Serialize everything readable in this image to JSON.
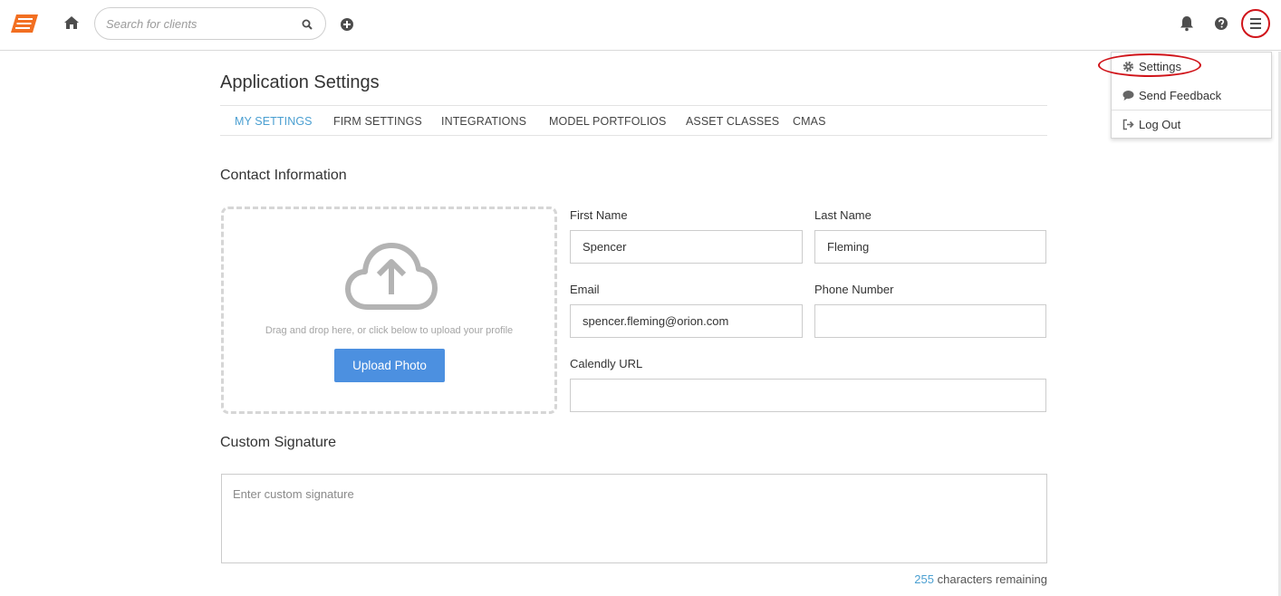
{
  "header": {
    "search": {
      "placeholder": "Search for clients",
      "value": ""
    }
  },
  "user_menu": {
    "items": [
      {
        "label": "Settings",
        "icon": "gear-icon"
      },
      {
        "label": "Send Feedback",
        "icon": "comment-icon"
      },
      {
        "label": "Log Out",
        "icon": "sign-out-icon"
      }
    ]
  },
  "page": {
    "title": "Application Settings",
    "tabs": [
      {
        "label": "MY SETTINGS",
        "active": true
      },
      {
        "label": "FIRM SETTINGS",
        "active": false
      },
      {
        "label": "INTEGRATIONS",
        "active": false
      },
      {
        "label": "MODEL PORTFOLIOS",
        "active": false
      },
      {
        "label": "ASSET CLASSES",
        "active": false
      },
      {
        "label": "CMAS",
        "active": false
      }
    ]
  },
  "contact": {
    "section_title": "Contact Information",
    "upload_hint": "Drag and drop here, or click below to upload your profile",
    "upload_button": "Upload Photo",
    "first_name": {
      "label": "First Name",
      "value": "Spencer"
    },
    "last_name": {
      "label": "Last Name",
      "value": "Fleming"
    },
    "email": {
      "label": "Email",
      "value": "spencer.fleming@orion.com"
    },
    "phone": {
      "label": "Phone Number",
      "value": ""
    },
    "calendly": {
      "label": "Calendly URL",
      "value": ""
    }
  },
  "signature": {
    "section_title": "Custom Signature",
    "placeholder": "Enter custom signature",
    "chars_remaining_count": "255",
    "chars_remaining_label": "characters remaining"
  },
  "colors": {
    "accent": "#4a9fd1",
    "button": "#4c90e0",
    "logo": "#f26f21",
    "annotation": "#d0141a"
  }
}
